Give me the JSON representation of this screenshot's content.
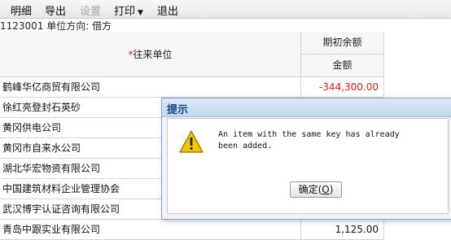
{
  "toolbar": {
    "items": [
      {
        "label": "明细",
        "enabled": true
      },
      {
        "label": "导出",
        "enabled": true
      },
      {
        "label": "设置",
        "enabled": false
      },
      {
        "label": "打印",
        "enabled": true,
        "dropdown_arrow": "▼"
      },
      {
        "label": "退出",
        "enabled": true
      }
    ]
  },
  "info_line": "1123001 单位方向: 借方",
  "table": {
    "header": {
      "name_col": "往来单位",
      "required_mark": "*",
      "group_col": "期初余额",
      "amount_col": "金额"
    },
    "rows": [
      {
        "name": "鹤峰华亿商贸有限公司",
        "amount": "-344,300.00",
        "negative": true
      },
      {
        "name": "徐红亮登封石英砂",
        "amount": ""
      },
      {
        "name": "黄冈供电公司",
        "amount": ""
      },
      {
        "name": "黄冈市自来水公司",
        "amount": ""
      },
      {
        "name": "湖北华宏物资有限公司",
        "amount": ""
      },
      {
        "name": "中国建筑材料企业管理协会",
        "amount": ""
      },
      {
        "name": "武汉博宇认证咨询有限公司",
        "amount": ""
      },
      {
        "name": "青岛中跟实业有限公司",
        "amount": "1,125.00"
      }
    ]
  },
  "dialog": {
    "title": "提示",
    "icon": "warning-icon",
    "message": "An item with the same key has already been added.",
    "ok_label": "确定(",
    "ok_mnemonic": "O",
    "ok_suffix": ")"
  },
  "colors": {
    "negative_amount": "#e02020",
    "required_mark": "#e02020",
    "dialog_title_text": "#15428b",
    "warning_fill": "#f5c400"
  }
}
